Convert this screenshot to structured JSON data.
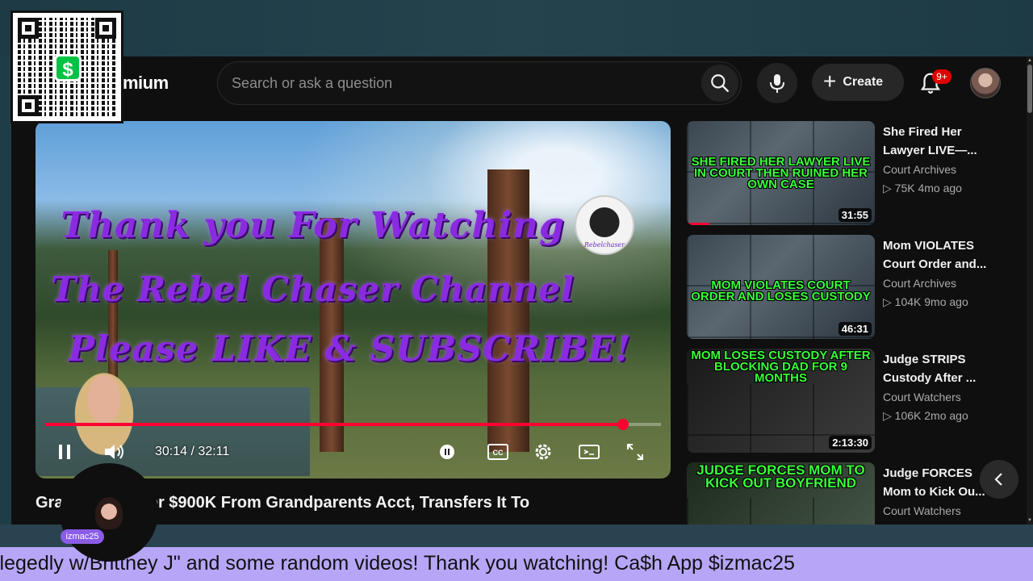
{
  "header": {
    "logo_partial": "mium",
    "search_placeholder": "Search or ask a question",
    "create_label": "Create",
    "notification_count": "9+"
  },
  "player": {
    "overlay_lines": [
      "Thank you For Watching",
      "The Rebel Chaser Channel",
      "Please LIKE & SUBSCRIBE!"
    ],
    "channel_logo_text": "Rebelchaser",
    "current_time": "30:14",
    "duration": "32:11",
    "time_display": "30:14 / 32:11",
    "progress_fraction": 0.939
  },
  "video": {
    "title_visible": "Gra         r Takes Over $900K From Grandparents Acct, Transfers It To"
  },
  "streamer": {
    "name": "izmac25"
  },
  "recommendations": [
    {
      "thumb_caption": "SHE FIRED HER LAWYER LIVE IN COURT THEN RUINED HER OWN CASE",
      "duration": "31:55",
      "title_line1": "She Fired Her",
      "title_line2": "Lawyer LIVE—...",
      "channel": "Court Archives",
      "meta": "▷ 75K  4mo ago",
      "watched_fraction": 0.12
    },
    {
      "thumb_caption": "MOM VIOLATES COURT ORDER AND LOSES CUSTODY",
      "duration": "46:31",
      "title_line1": "Mom VIOLATES",
      "title_line2": "Court Order and...",
      "channel": "Court Archives",
      "meta": "▷ 104K  9mo ago",
      "watched_fraction": 0
    },
    {
      "thumb_caption": "MOM LOSES CUSTODY AFTER BLOCKING DAD FOR 9 MONTHS",
      "duration": "2:13:30",
      "title_line1": "Judge STRIPS",
      "title_line2": "Custody After ...",
      "channel": "Court Watchers",
      "meta": "▷ 106K  2mo ago",
      "watched_fraction": 0
    },
    {
      "thumb_caption": "JUDGE FORCES MOM TO KICK OUT BOYFRIEND",
      "duration": "",
      "title_line1": "Judge FORCES",
      "title_line2": "Mom to Kick Ou...",
      "channel": "Court Watchers",
      "meta": "",
      "watched_fraction": 0
    }
  ],
  "ticker": {
    "text": "llegedly w/Brittney J\" and some random videos! Thank you watching! Ca$h App $izmac25"
  },
  "colors": {
    "accent_red": "#ff0033",
    "overlay_purple": "#8a2be2",
    "ticker_bg": "#b7a6f7",
    "thumb_caption_green": "#39ff3a"
  }
}
